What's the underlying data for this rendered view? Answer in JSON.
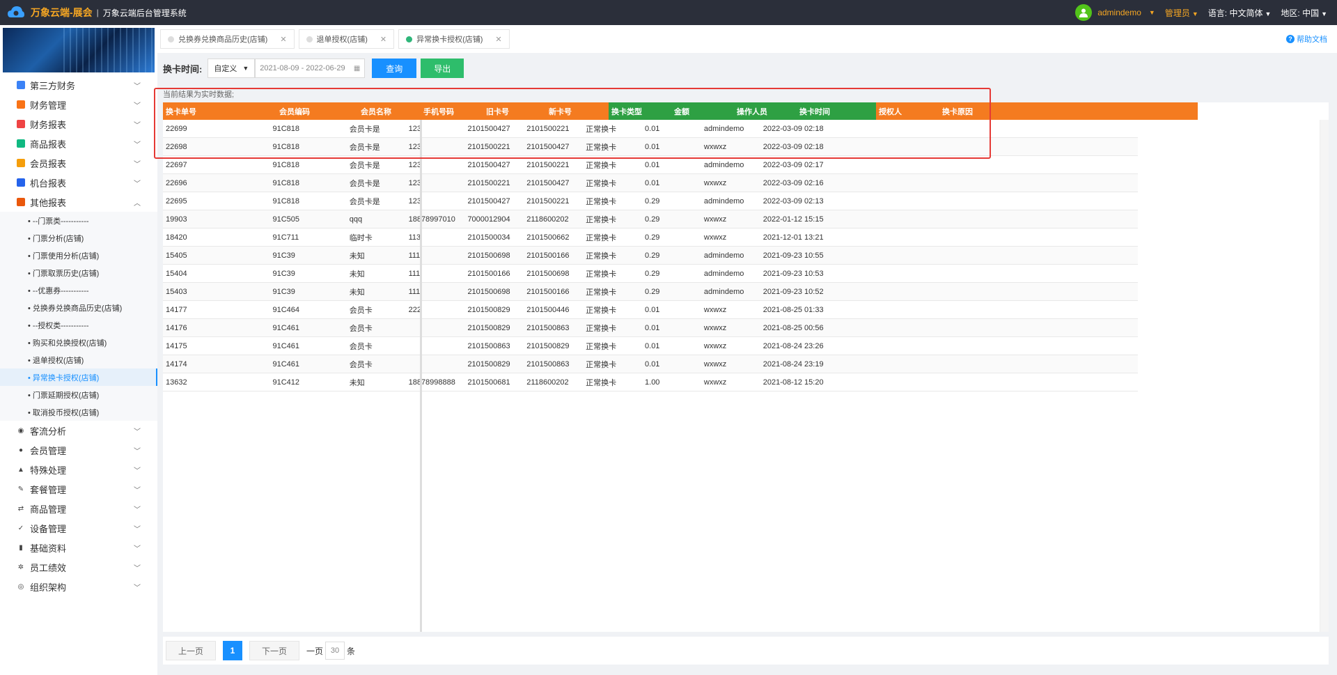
{
  "header": {
    "brand": "万象云端-展会",
    "separator": "|",
    "subtitle": "万象云端后台管理系统",
    "user": "admindemo",
    "role": "管理员",
    "language_label": "语言:",
    "language_value": "中文简体",
    "region_label": "地区:",
    "region_value": "中国"
  },
  "sidebar": {
    "items_top": [
      {
        "label": "第三方财务",
        "color": "#3b82f6"
      },
      {
        "label": "财务管理",
        "color": "#f97316"
      },
      {
        "label": "财务报表",
        "color": "#ef4444"
      },
      {
        "label": "商品报表",
        "color": "#10b981"
      },
      {
        "label": "会员报表",
        "color": "#f59e0b"
      },
      {
        "label": "机台报表",
        "color": "#2563eb"
      },
      {
        "label": "其他报表",
        "color": "#ea580c"
      }
    ],
    "sub_items": [
      "• --门票类-----------",
      "• 门票分析(店铺)",
      "• 门票使用分析(店铺)",
      "• 门票取票历史(店铺)",
      "• --优惠券-----------",
      "• 兑换券兑换商品历史(店铺)",
      "• --授权类-----------",
      "• 购买和兑换授权(店铺)",
      "• 退单授权(店铺)",
      "• 异常换卡授权(店铺)",
      "• 门票延期授权(店铺)",
      "• 取消投币授权(店铺)"
    ],
    "active_sub_index": 9,
    "items_bottom": [
      {
        "label": "客流分析",
        "icon": "eye-icon"
      },
      {
        "label": "会员管理",
        "icon": "user-icon"
      },
      {
        "label": "特殊处理",
        "icon": "warning-icon"
      },
      {
        "label": "套餐管理",
        "icon": "edit-icon"
      },
      {
        "label": "商品管理",
        "icon": "swap-icon"
      },
      {
        "label": "设备管理",
        "icon": "tool-icon"
      },
      {
        "label": "基础资料",
        "icon": "file-icon"
      },
      {
        "label": "员工绩效",
        "icon": "gear-icon"
      },
      {
        "label": "组织架构",
        "icon": "target-icon"
      }
    ]
  },
  "tabs": [
    {
      "label": "兑换券兑换商品历史(店铺)",
      "active": false
    },
    {
      "label": "退单授权(店铺)",
      "active": false
    },
    {
      "label": "异常换卡授权(店铺)",
      "active": true
    }
  ],
  "help_label": "帮助文档",
  "filters": {
    "label": "换卡时间:",
    "mode": "自定义",
    "date_range": "2021-08-09 - 2022-06-29",
    "query_label": "查询",
    "export_label": "导出"
  },
  "notice": "当前结果为实时数据;",
  "table": {
    "columns": [
      {
        "label": "换卡单号",
        "color": "#f47b20"
      },
      {
        "label": "会员编码",
        "color": "#f47b20"
      },
      {
        "label": "会员名称",
        "color": "#f47b20"
      },
      {
        "label": "手机号码",
        "color": "#f47b20"
      },
      {
        "label": "旧卡号",
        "color": "#f47b20"
      },
      {
        "label": "新卡号",
        "color": "#f47b20"
      },
      {
        "label": "换卡类型",
        "color": "#2ea043"
      },
      {
        "label": "金额",
        "color": "#2ea043"
      },
      {
        "label": "操作人员",
        "color": "#2ea043"
      },
      {
        "label": "换卡时间",
        "color": "#2ea043"
      },
      {
        "label": "授权人",
        "color": "#f47b20"
      },
      {
        "label": "换卡原因",
        "color": "#f47b20"
      }
    ],
    "rows": [
      [
        "22699",
        "91C818",
        "会员卡是",
        "123",
        "2101500427",
        "2101500221",
        "正常换卡",
        "0.01",
        "admindemo",
        "2022-03-09 02:18",
        "",
        ""
      ],
      [
        "22698",
        "91C818",
        "会员卡是",
        "123",
        "2101500221",
        "2101500427",
        "正常换卡",
        "0.01",
        "wxwxz",
        "2022-03-09 02:18",
        "",
        ""
      ],
      [
        "22697",
        "91C818",
        "会员卡是",
        "123",
        "2101500427",
        "2101500221",
        "正常换卡",
        "0.01",
        "admindemo",
        "2022-03-09 02:17",
        "",
        ""
      ],
      [
        "22696",
        "91C818",
        "会员卡是",
        "123",
        "2101500221",
        "2101500427",
        "正常换卡",
        "0.01",
        "wxwxz",
        "2022-03-09 02:16",
        "",
        ""
      ],
      [
        "22695",
        "91C818",
        "会员卡是",
        "123",
        "2101500427",
        "2101500221",
        "正常换卡",
        "0.29",
        "admindemo",
        "2022-03-09 02:13",
        "",
        ""
      ],
      [
        "19903",
        "91C505",
        "qqq",
        "18878997010",
        "7000012904",
        "2118600202",
        "正常换卡",
        "0.29",
        "wxwxz",
        "2022-01-12 15:15",
        "",
        ""
      ],
      [
        "18420",
        "91C711",
        "临时卡",
        "113",
        "2101500034",
        "2101500662",
        "正常换卡",
        "0.29",
        "wxwxz",
        "2021-12-01 13:21",
        "",
        ""
      ],
      [
        "15405",
        "91C39",
        "未知",
        "111",
        "2101500698",
        "2101500166",
        "正常换卡",
        "0.29",
        "admindemo",
        "2021-09-23 10:55",
        "",
        ""
      ],
      [
        "15404",
        "91C39",
        "未知",
        "111",
        "2101500166",
        "2101500698",
        "正常换卡",
        "0.29",
        "admindemo",
        "2021-09-23 10:53",
        "",
        ""
      ],
      [
        "15403",
        "91C39",
        "未知",
        "111",
        "2101500698",
        "2101500166",
        "正常换卡",
        "0.29",
        "admindemo",
        "2021-09-23 10:52",
        "",
        ""
      ],
      [
        "14177",
        "91C464",
        "会员卡",
        "222",
        "2101500829",
        "2101500446",
        "正常换卡",
        "0.01",
        "wxwxz",
        "2021-08-25 01:33",
        "",
        ""
      ],
      [
        "14176",
        "91C461",
        "会员卡",
        "",
        "2101500829",
        "2101500863",
        "正常换卡",
        "0.01",
        "wxwxz",
        "2021-08-25 00:56",
        "",
        ""
      ],
      [
        "14175",
        "91C461",
        "会员卡",
        "",
        "2101500863",
        "2101500829",
        "正常换卡",
        "0.01",
        "wxwxz",
        "2021-08-24 23:26",
        "",
        ""
      ],
      [
        "14174",
        "91C461",
        "会员卡",
        "",
        "2101500829",
        "2101500863",
        "正常换卡",
        "0.01",
        "wxwxz",
        "2021-08-24 23:19",
        "",
        ""
      ],
      [
        "13632",
        "91C412",
        "未知",
        "18878998888",
        "2101500681",
        "2118600202",
        "正常换卡",
        "1.00",
        "wxwxz",
        "2021-08-12 15:20",
        "",
        ""
      ]
    ]
  },
  "pager": {
    "prev_label": "上一页",
    "current_page": "1",
    "next_label": "下一页",
    "per_page_prefix": "一页",
    "per_page_value": "30",
    "per_page_suffix": "条"
  }
}
